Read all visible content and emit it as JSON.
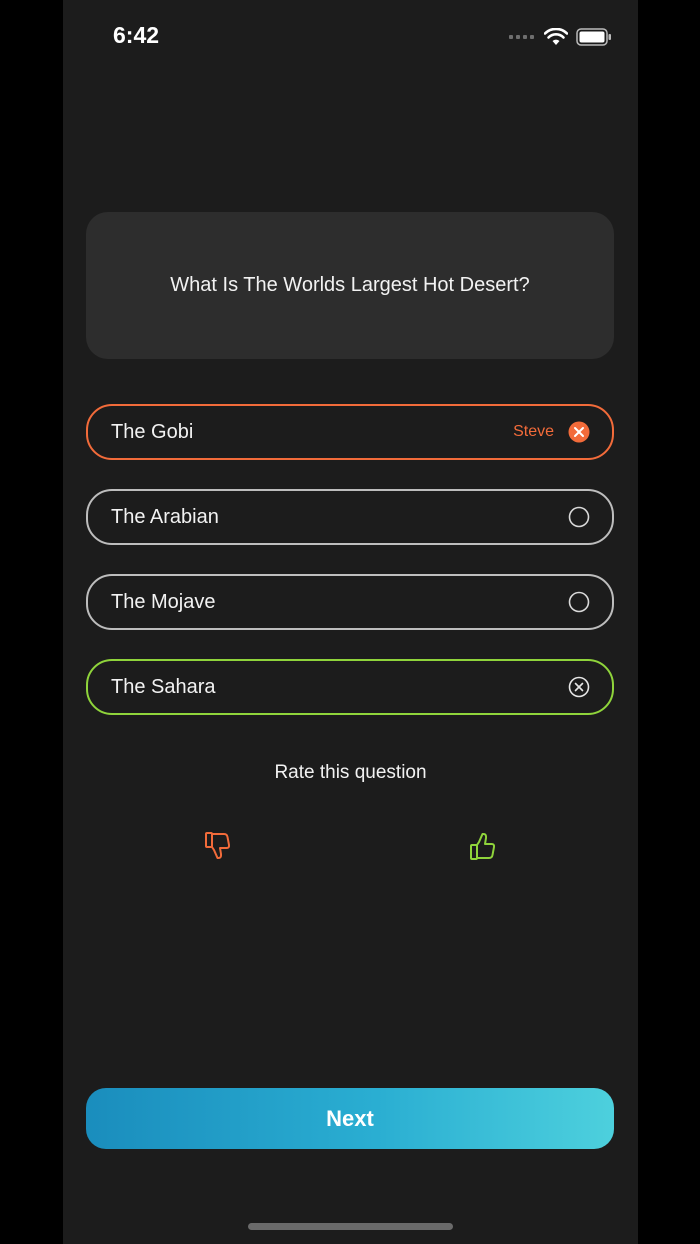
{
  "status_bar": {
    "time": "6:42"
  },
  "question": {
    "text": "What Is The Worlds Largest Hot Desert?"
  },
  "answers": [
    {
      "label": "The Gobi",
      "state": "wrong",
      "picked_by": "Steve",
      "icon": "x-circle-filled-icon"
    },
    {
      "label": "The Arabian",
      "state": "unselected",
      "icon": "radio-empty-icon"
    },
    {
      "label": "The Mojave",
      "state": "unselected",
      "icon": "radio-empty-icon"
    },
    {
      "label": "The Sahara",
      "state": "correct",
      "icon": "x-circle-outline-icon"
    }
  ],
  "rating": {
    "label": "Rate this question",
    "thumbs_down_icon": "thumbs-down-icon",
    "thumbs_up_icon": "thumbs-up-icon"
  },
  "next_button": {
    "label": "Next"
  },
  "colors": {
    "wrong": "#f26b3a",
    "correct": "#8fd43b",
    "neutral_border": "#bdbdbd",
    "card_bg": "#2d2d2d",
    "screen_bg": "#1c1c1c",
    "next_gradient_start": "#1a8dbd",
    "next_gradient_end": "#4dd0dd"
  }
}
